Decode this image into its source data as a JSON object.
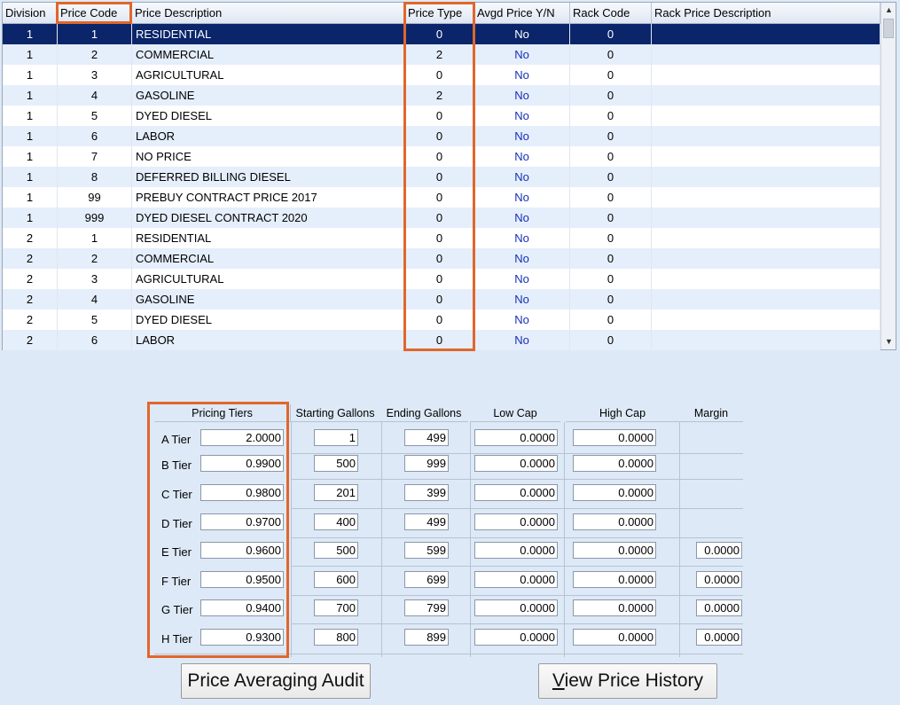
{
  "grid": {
    "columns": [
      "Division",
      "Price Code",
      "Price Description",
      "Price Type",
      "Avgd Price Y/N",
      "Rack Code",
      "Rack Price Description"
    ],
    "rows": [
      {
        "division": "1",
        "code": "1",
        "desc": "RESIDENTIAL",
        "ptype": "0",
        "avg": "No",
        "rack": "0",
        "rdesc": "",
        "selected": true
      },
      {
        "division": "1",
        "code": "2",
        "desc": "COMMERCIAL",
        "ptype": "2",
        "avg": "No",
        "rack": "0",
        "rdesc": ""
      },
      {
        "division": "1",
        "code": "3",
        "desc": "AGRICULTURAL",
        "ptype": "0",
        "avg": "No",
        "rack": "0",
        "rdesc": ""
      },
      {
        "division": "1",
        "code": "4",
        "desc": "GASOLINE",
        "ptype": "2",
        "avg": "No",
        "rack": "0",
        "rdesc": ""
      },
      {
        "division": "1",
        "code": "5",
        "desc": "DYED DIESEL",
        "ptype": "0",
        "avg": "No",
        "rack": "0",
        "rdesc": ""
      },
      {
        "division": "1",
        "code": "6",
        "desc": "LABOR",
        "ptype": "0",
        "avg": "No",
        "rack": "0",
        "rdesc": ""
      },
      {
        "division": "1",
        "code": "7",
        "desc": "NO PRICE",
        "ptype": "0",
        "avg": "No",
        "rack": "0",
        "rdesc": ""
      },
      {
        "division": "1",
        "code": "8",
        "desc": "DEFERRED BILLING DIESEL",
        "ptype": "0",
        "avg": "No",
        "rack": "0",
        "rdesc": ""
      },
      {
        "division": "1",
        "code": "99",
        "desc": "PREBUY CONTRACT PRICE 2017",
        "ptype": "0",
        "avg": "No",
        "rack": "0",
        "rdesc": ""
      },
      {
        "division": "1",
        "code": "999",
        "desc": "DYED DIESEL CONTRACT 2020",
        "ptype": "0",
        "avg": "No",
        "rack": "0",
        "rdesc": ""
      },
      {
        "division": "2",
        "code": "1",
        "desc": "RESIDENTIAL",
        "ptype": "0",
        "avg": "No",
        "rack": "0",
        "rdesc": ""
      },
      {
        "division": "2",
        "code": "2",
        "desc": "COMMERCIAL",
        "ptype": "0",
        "avg": "No",
        "rack": "0",
        "rdesc": ""
      },
      {
        "division": "2",
        "code": "3",
        "desc": "AGRICULTURAL",
        "ptype": "0",
        "avg": "No",
        "rack": "0",
        "rdesc": ""
      },
      {
        "division": "2",
        "code": "4",
        "desc": "GASOLINE",
        "ptype": "0",
        "avg": "No",
        "rack": "0",
        "rdesc": ""
      },
      {
        "division": "2",
        "code": "5",
        "desc": "DYED DIESEL",
        "ptype": "0",
        "avg": "No",
        "rack": "0",
        "rdesc": ""
      },
      {
        "division": "2",
        "code": "6",
        "desc": "LABOR",
        "ptype": "0",
        "avg": "No",
        "rack": "0",
        "rdesc": ""
      }
    ]
  },
  "tiers": {
    "headers": {
      "pricing_tiers": "Pricing Tiers",
      "starting_gallons": "Starting Gallons",
      "ending_gallons": "Ending Gallons",
      "low_cap": "Low Cap",
      "high_cap": "High Cap",
      "margin": "Margin"
    },
    "rows": [
      {
        "label": "A Tier",
        "price": "2.0000",
        "start": "1",
        "end": "499",
        "low": "0.0000",
        "high": "0.0000",
        "margin": ""
      },
      {
        "label": "B Tier",
        "price": "0.9900",
        "start": "500",
        "end": "999",
        "low": "0.0000",
        "high": "0.0000",
        "margin": ""
      },
      {
        "label": "C Tier",
        "price": "0.9800",
        "start": "201",
        "end": "399",
        "low": "0.0000",
        "high": "0.0000",
        "margin": ""
      },
      {
        "label": "D Tier",
        "price": "0.9700",
        "start": "400",
        "end": "499",
        "low": "0.0000",
        "high": "0.0000",
        "margin": ""
      },
      {
        "label": "E Tier",
        "price": "0.9600",
        "start": "500",
        "end": "599",
        "low": "0.0000",
        "high": "0.0000",
        "margin": "0.0000"
      },
      {
        "label": "F Tier",
        "price": "0.9500",
        "start": "600",
        "end": "699",
        "low": "0.0000",
        "high": "0.0000",
        "margin": "0.0000"
      },
      {
        "label": "G Tier",
        "price": "0.9400",
        "start": "700",
        "end": "799",
        "low": "0.0000",
        "high": "0.0000",
        "margin": "0.0000"
      },
      {
        "label": "H Tier",
        "price": "0.9300",
        "start": "800",
        "end": "899",
        "low": "0.0000",
        "high": "0.0000",
        "margin": "0.0000"
      }
    ]
  },
  "buttons": {
    "audit": "Price Averaging Audit",
    "history_mnemonic": "V",
    "history_rest": "iew Price History"
  },
  "colors": {
    "highlight": "#e0672b",
    "selected_row": "#0a2569",
    "yn_text": "#1530b8",
    "background": "#dde9f7"
  }
}
